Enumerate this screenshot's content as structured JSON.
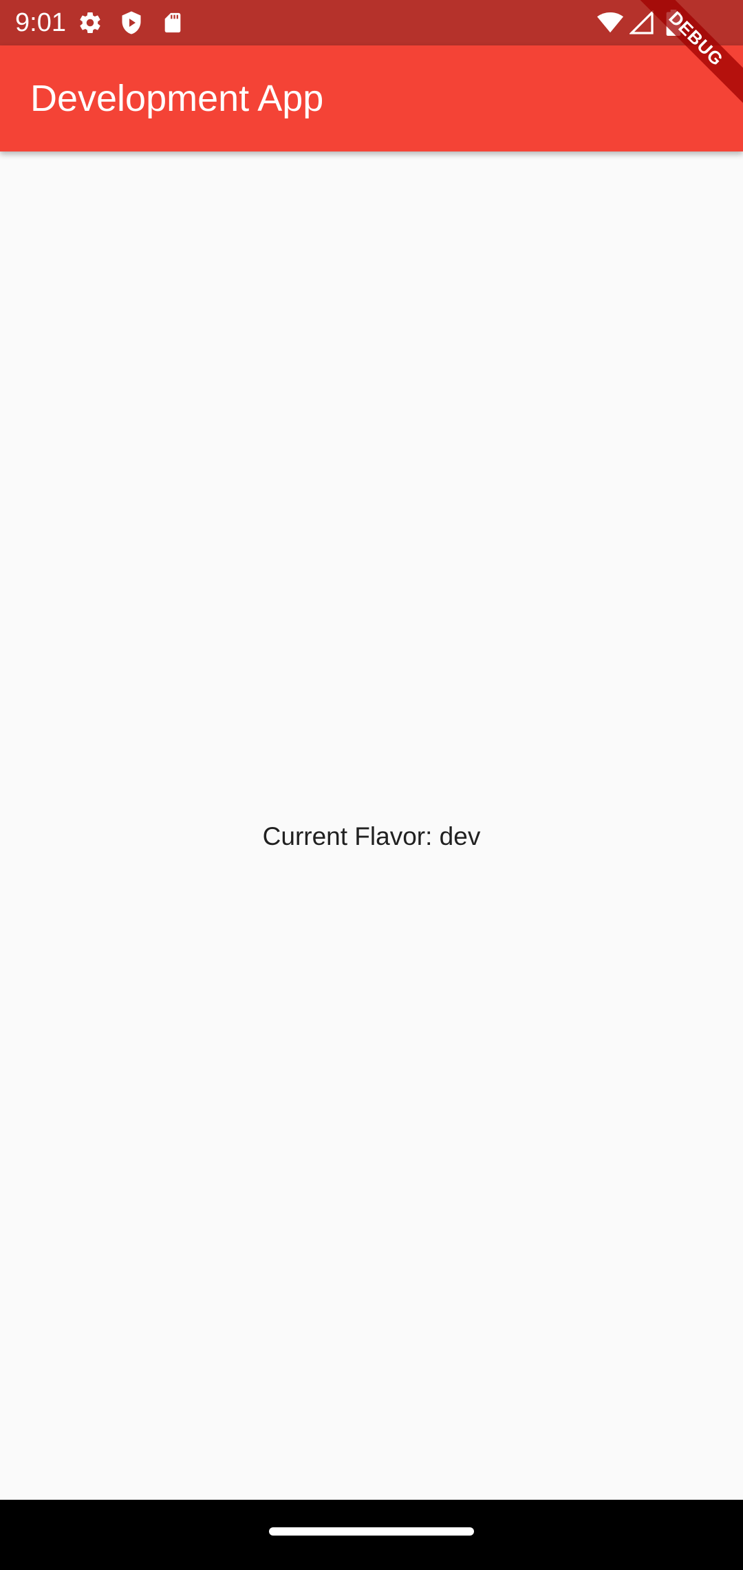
{
  "status_bar": {
    "time": "9:01",
    "background": "#b5322b",
    "left_icons": [
      "gear-icon",
      "shield-play-icon",
      "sd-card-icon"
    ],
    "right_icons": [
      "wifi-icon",
      "cell-signal-icon",
      "battery-icon"
    ]
  },
  "app_bar": {
    "title": "Development App",
    "background": "#f44336"
  },
  "debug_banner": {
    "label": "DEBUG"
  },
  "main": {
    "flavor_text": "Current Flavor: dev"
  },
  "nav_bar": {
    "background": "#000000",
    "handle": "home-handle"
  }
}
